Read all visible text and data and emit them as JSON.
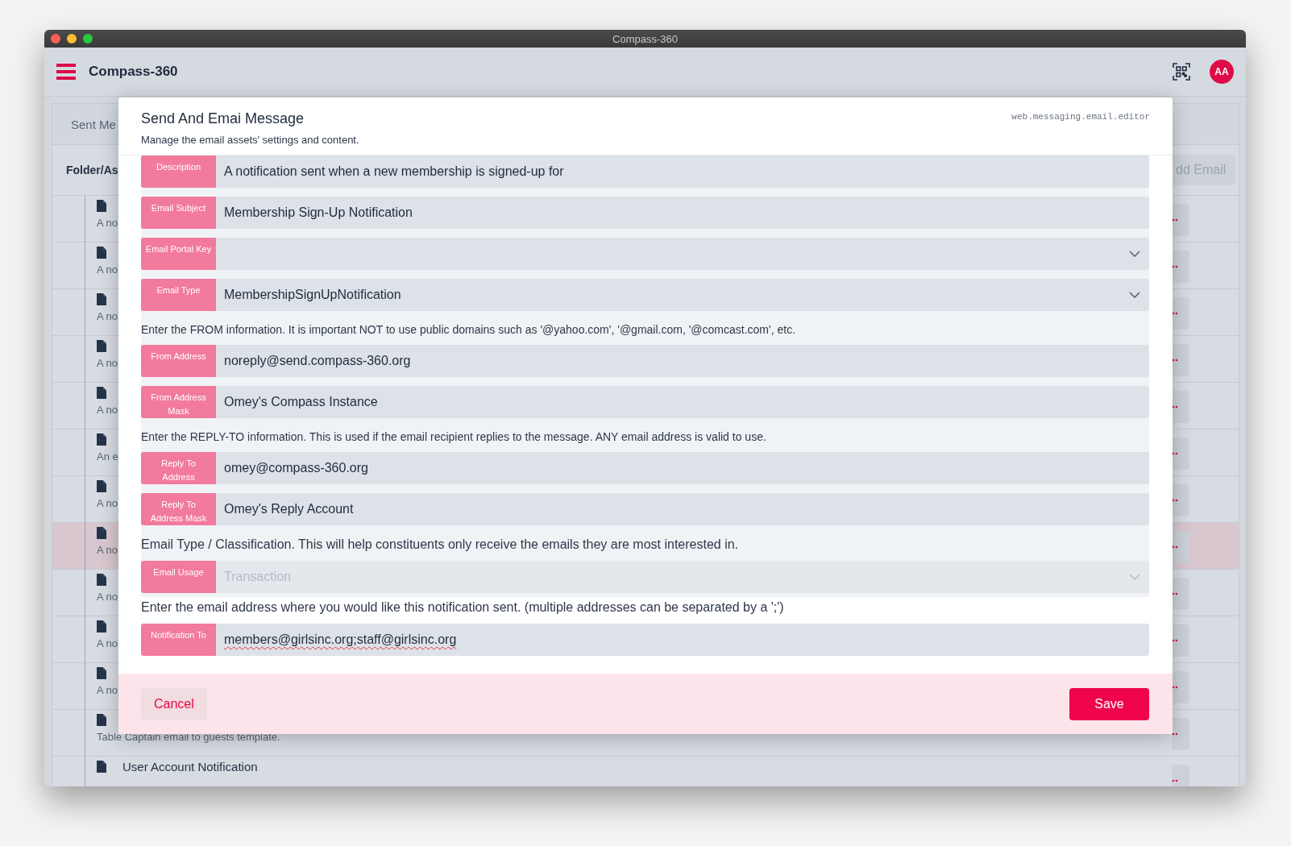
{
  "window": {
    "title": "Compass-360"
  },
  "app_header": {
    "title": "Compass-360",
    "avatar": "AA"
  },
  "background": {
    "tab": "Sent Me",
    "column_header": "Folder/As",
    "add_button": "dd Email",
    "rows": [
      {
        "description": "A no",
        "selected": false
      },
      {
        "description": "A no",
        "selected": false
      },
      {
        "description": "A no",
        "selected": false
      },
      {
        "description": "A no",
        "selected": false
      },
      {
        "description": "A no",
        "selected": false
      },
      {
        "description": "An e",
        "selected": false
      },
      {
        "description": "A no",
        "selected": false
      },
      {
        "description": "A no",
        "selected": true
      },
      {
        "description": "A no",
        "selected": false
      },
      {
        "description": "A no",
        "selected": false
      },
      {
        "description": "A no",
        "selected": false
      },
      {
        "description": "Table Captain email to guests template.",
        "selected": false
      },
      {
        "title": "User Account Notification",
        "selected": false
      }
    ]
  },
  "dialog": {
    "title": "Send And Emai Message",
    "subtitle": "Manage the email assets' settings and content.",
    "code": "web.messaging.email.editor",
    "sections": [
      {
        "shaded": true,
        "items": [
          {
            "kind": "input",
            "label": "Description",
            "value": "A notification sent when a new membership is signed-up for",
            "disabled": false,
            "misspelled": false
          },
          {
            "kind": "input",
            "label": "Email Subject",
            "value": "Membership Sign-Up Notification",
            "disabled": false,
            "misspelled": false
          },
          {
            "kind": "select",
            "label": "Email Portal Key",
            "disabled": false
          },
          {
            "kind": "select",
            "label": "Email Type",
            "value": "MembershipSignUpNotification",
            "disabled": false,
            "misspelled": false
          },
          {
            "kind": "hint",
            "text": "Enter the FROM information. It is important NOT to use public domains such as '@yahoo.com', '@gmail.com, '@comcast.com', etc."
          },
          {
            "kind": "input",
            "label": "From Address",
            "value": "noreply@send.compass-360.org",
            "disabled": false,
            "misspelled": false
          },
          {
            "kind": "input",
            "label": "From Address Mask",
            "value": "Omey's Compass Instance",
            "disabled": false,
            "misspelled": false
          },
          {
            "kind": "hint",
            "text": "Enter the REPLY-TO information. This is used if the email recipient replies to the message. ANY email address is valid to use."
          },
          {
            "kind": "input",
            "label": "Reply To Address",
            "value": "omey@compass-360.org",
            "disabled": false,
            "misspelled": false
          },
          {
            "kind": "input",
            "label": "Reply To Address Mask",
            "value": "Omey's Reply Account",
            "disabled": false,
            "misspelled": false
          },
          {
            "kind": "note",
            "text": "Email Type / Classification. This will help constituents only receive the emails they are most interested in."
          },
          {
            "kind": "select",
            "label": "Email Usage",
            "value": "Transaction",
            "disabled": true,
            "misspelled": false
          }
        ]
      },
      {
        "shaded": false,
        "items": [
          {
            "kind": "note",
            "text": "Enter the email address where you would like this notification sent. (multiple addresses can be separated by a ';')"
          },
          {
            "kind": "input",
            "label": "Notification To",
            "value": "members@girlsinc.org;staff@girlsinc.org",
            "disabled": false,
            "misspelled": true
          }
        ]
      }
    ],
    "buttons": [
      {
        "kind": "secondary",
        "label": "Cancel"
      },
      {
        "kind": "primary",
        "label": "Save"
      }
    ]
  }
}
